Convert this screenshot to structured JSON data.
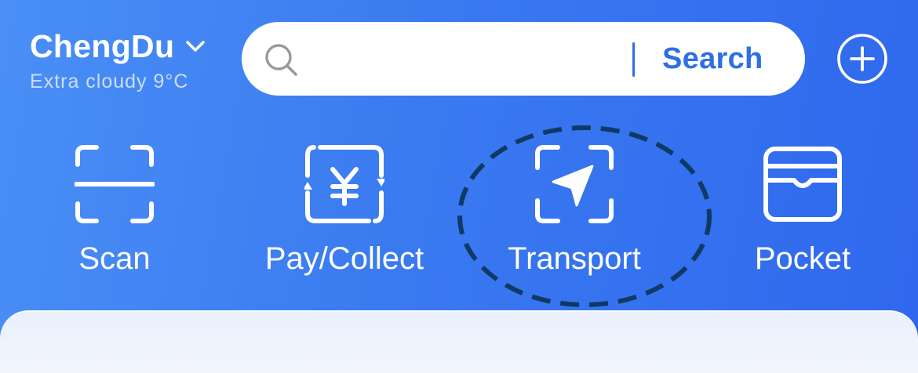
{
  "location": {
    "city": "ChengDu",
    "weather": "Extra cloudy 9°C"
  },
  "search": {
    "placeholder": "",
    "button_label": "Search"
  },
  "quick_actions": [
    {
      "label": "Scan",
      "icon": "scan-icon"
    },
    {
      "label": "Pay/Collect",
      "icon": "pay-collect-icon"
    },
    {
      "label": "Transport",
      "icon": "transport-icon",
      "highlighted": true
    },
    {
      "label": "Pocket",
      "icon": "pocket-icon"
    }
  ],
  "colors": {
    "background_start": "#4a8ff6",
    "background_end": "#2f68ee",
    "accent": "#2f6fe6",
    "highlight_ring": "#0f3a66"
  }
}
